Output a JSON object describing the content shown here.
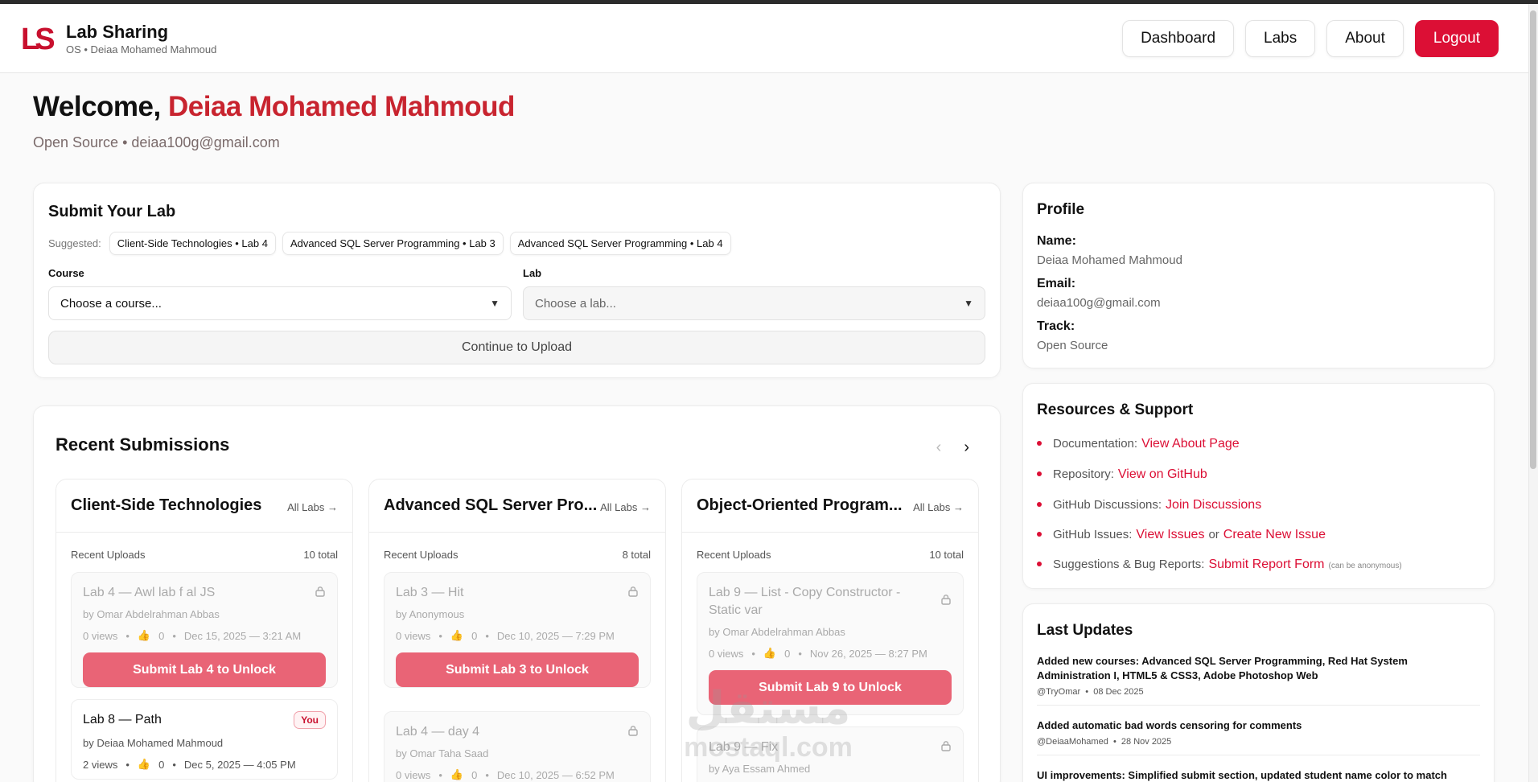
{
  "brand": {
    "logo": "LS",
    "title": "Lab Sharing",
    "subtitle": "OS • Deiaa Mohamed Mahmoud"
  },
  "nav": {
    "dashboard": "Dashboard",
    "labs": "Labs",
    "about": "About",
    "logout": "Logout"
  },
  "welcome": {
    "prefix": "Welcome,",
    "name": "Deiaa Mohamed Mahmoud",
    "subline": "Open Source • deiaa100g@gmail.com"
  },
  "submit": {
    "title": "Submit Your Lab",
    "suggested_label": "Suggested:",
    "suggestions": [
      "Client-Side Technologies • Lab 4",
      "Advanced SQL Server Programming • Lab 3",
      "Advanced SQL Server Programming • Lab 4"
    ],
    "course_label": "Course",
    "course_value": "Choose a course...",
    "lab_label": "Lab",
    "lab_value": "Choose a lab...",
    "continue_label": "Continue to Upload"
  },
  "recent": {
    "title": "Recent Submissions",
    "courses": [
      {
        "title": "Client-Side Technologies",
        "all_labs": "All Labs →",
        "recent_label": "Recent Uploads",
        "total": "10 total",
        "labs": [
          {
            "title": "Lab 4 — Awl lab f al JS",
            "by": "by Omar Abdelrahman Abbas",
            "views": "0 views",
            "likes": "0",
            "date": "Dec 15, 2025 — 3:21 AM",
            "unlock": "Submit Lab 4 to Unlock"
          },
          {
            "title": "Lab 8 — Path",
            "by": "by Deiaa Mohamed Mahmoud",
            "views": "2 views",
            "likes": "0",
            "date": "Dec 5, 2025 — 4:05 PM",
            "badge": "You"
          }
        ]
      },
      {
        "title": "Advanced SQL Server Pro...",
        "all_labs": "All Labs →",
        "recent_label": "Recent Uploads",
        "total": "8 total",
        "labs": [
          {
            "title": "Lab 3 — Hit",
            "by": "by Anonymous",
            "views": "0 views",
            "likes": "0",
            "date": "Dec 10, 2025 — 7:29 PM",
            "unlock": "Submit Lab 3 to Unlock"
          },
          {
            "title": "Lab 4 — day 4",
            "by": "by Omar Taha Saad",
            "views": "0 views",
            "likes": "0",
            "date": "Dec 10, 2025 — 6:52 PM"
          }
        ]
      },
      {
        "title": "Object-Oriented Program...",
        "all_labs": "All Labs →",
        "recent_label": "Recent Uploads",
        "total": "10 total",
        "labs": [
          {
            "title": "Lab 9 — List - Copy Constructor - Static var",
            "by": "by Omar Abdelrahman Abbas",
            "views": "0 views",
            "likes": "0",
            "date": "Nov 26, 2025 — 8:27 PM",
            "unlock": "Submit Lab 9 to Unlock"
          },
          {
            "title": "Lab 9 — Fix",
            "by": "by Aya Essam Ahmed"
          }
        ]
      }
    ]
  },
  "profile": {
    "title": "Profile",
    "name_label": "Name:",
    "name": "Deiaa Mohamed Mahmoud",
    "email_label": "Email:",
    "email": "deiaa100g@gmail.com",
    "track_label": "Track:",
    "track": "Open Source"
  },
  "resources": {
    "title": "Resources & Support",
    "items": [
      {
        "label": "Documentation:",
        "link": "View About Page"
      },
      {
        "label": "Repository:",
        "link": "View on GitHub"
      },
      {
        "label": "GitHub Discussions:",
        "link": "Join Discussions"
      },
      {
        "label": "GitHub Issues:",
        "link": "View Issues",
        "mid": "or",
        "link2": "Create New Issue"
      },
      {
        "label": "Suggestions & Bug Reports:",
        "link": "Submit Report Form",
        "note": "(can be anonymous)"
      }
    ]
  },
  "updates": {
    "title": "Last Updates",
    "items": [
      {
        "title": "Added new courses: Advanced SQL Server Programming, Red Hat System Administration I, HTML5 & CSS3, Adobe Photoshop Web",
        "author": "@TryOmar",
        "date": "08 Dec 2025"
      },
      {
        "title": "Added automatic bad words censoring for comments",
        "author": "@DeiaaMohamed",
        "date": "28 Nov 2025"
      },
      {
        "title": "UI improvements: Simplified submit section, updated student name color to match"
      }
    ]
  },
  "watermark": {
    "arabic": "مستقل",
    "latin": "mostaql.com"
  },
  "colors": {
    "accent": "#dc0f35",
    "unlock": "#e96476",
    "name": "#c8242f"
  }
}
